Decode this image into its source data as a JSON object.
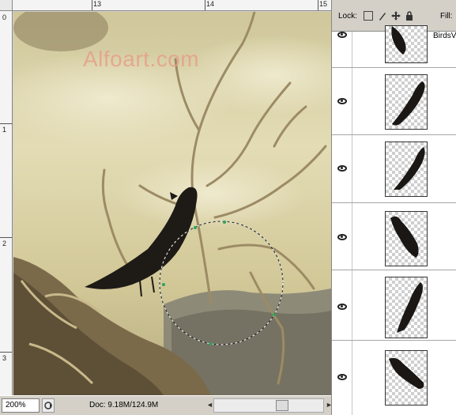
{
  "rulers": {
    "top": [
      "13",
      "14",
      "15"
    ],
    "left": [
      "0",
      "1",
      "2",
      "3"
    ]
  },
  "watermark": "Alfoart.com",
  "status": {
    "zoom": "200%",
    "doc_info": "Doc: 9.18M/124.9M",
    "arrow_left": "◄",
    "arrow_right": "►"
  },
  "layers_panel": {
    "lock_label": "Lock:",
    "fill_label": "Fill:",
    "lock_icons": [
      "lock-transparent-icon",
      "lock-brush-icon",
      "lock-move-icon",
      "lock-all-icon"
    ],
    "layers": [
      {
        "name": "BirdsVa",
        "visible": true
      },
      {
        "name": "",
        "visible": true
      },
      {
        "name": "",
        "visible": true
      },
      {
        "name": "",
        "visible": true
      },
      {
        "name": "",
        "visible": true
      },
      {
        "name": "",
        "visible": true
      }
    ]
  },
  "colors": {
    "sky": "#d8cfa3",
    "panel_bg": "#d4d0c8",
    "watermark": "#e79a85"
  }
}
